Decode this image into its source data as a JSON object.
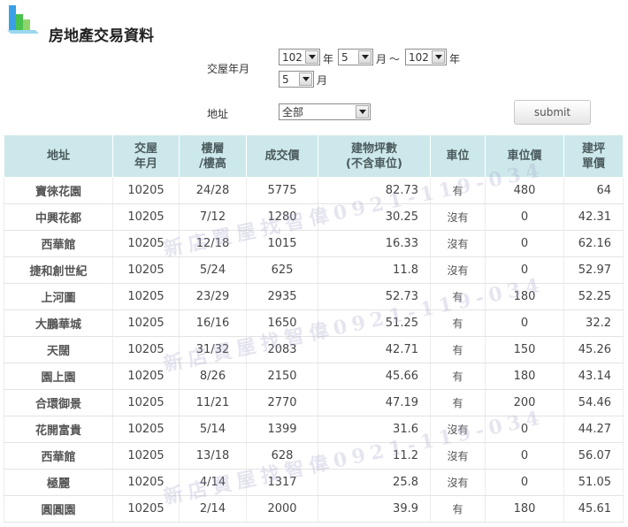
{
  "header": {
    "title": "房地產交易資料",
    "logo_icon": "bar-chart-icon"
  },
  "form": {
    "date_label": "交屋年月",
    "from_year": "102",
    "from_month": "5",
    "to_year": "102",
    "to_month": "5",
    "year_unit": "年",
    "month_unit": "月",
    "range_sep": "～",
    "address_label": "地址",
    "address_value": "全部",
    "submit_label": "submit"
  },
  "table": {
    "headers": [
      "地址",
      "交屋\n年月",
      "樓層\n/樓高",
      "成交價",
      "建物坪數\n(不含車位)",
      "車位",
      "車位價",
      "建坪\n單價"
    ],
    "rows": [
      [
        "寶徠花園",
        "10205",
        "24/28",
        "5775",
        "82.73",
        "有",
        "480",
        "64"
      ],
      [
        "中興花都",
        "10205",
        "7/12",
        "1280",
        "30.25",
        "沒有",
        "0",
        "42.31"
      ],
      [
        "西華館",
        "10205",
        "12/18",
        "1015",
        "16.33",
        "沒有",
        "0",
        "62.16"
      ],
      [
        "捷和創世紀",
        "10205",
        "5/24",
        "625",
        "11.8",
        "沒有",
        "0",
        "52.97"
      ],
      [
        "上河圖",
        "10205",
        "23/29",
        "2935",
        "52.73",
        "有",
        "180",
        "52.25"
      ],
      [
        "大鵬華城",
        "10205",
        "16/16",
        "1650",
        "51.25",
        "有",
        "0",
        "32.2"
      ],
      [
        "天闊",
        "10205",
        "31/32",
        "2083",
        "42.71",
        "有",
        "150",
        "45.26"
      ],
      [
        "園上園",
        "10205",
        "8/26",
        "2150",
        "45.66",
        "有",
        "180",
        "43.14"
      ],
      [
        "合環御景",
        "10205",
        "11/21",
        "2770",
        "47.19",
        "有",
        "200",
        "54.46"
      ],
      [
        "花開富貴",
        "10205",
        "5/14",
        "1399",
        "31.6",
        "沒有",
        "0",
        "44.27"
      ],
      [
        "西華館",
        "10205",
        "13/18",
        "628",
        "11.2",
        "沒有",
        "0",
        "56.07"
      ],
      [
        "極麗",
        "10205",
        "4/14",
        "1317",
        "25.8",
        "沒有",
        "0",
        "51.05"
      ],
      [
        "圓圓園",
        "10205",
        "2/14",
        "2000",
        "39.9",
        "有",
        "180",
        "45.61"
      ]
    ]
  },
  "watermark": "新店買屋找智偉0921-119-034"
}
